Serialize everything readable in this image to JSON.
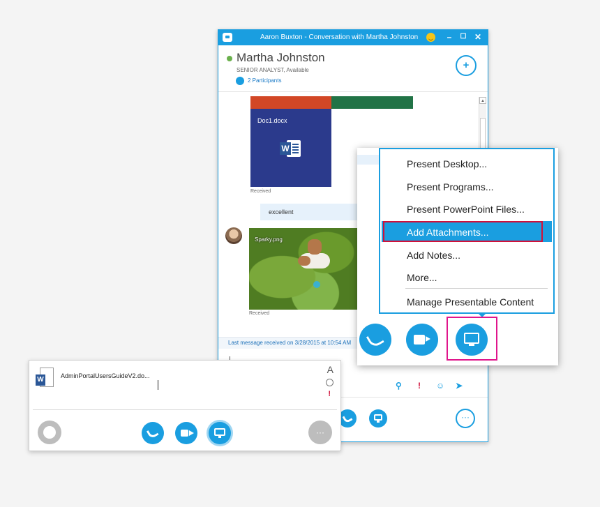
{
  "window": {
    "title": "Aaron Buxton - Conversation with Martha Johnston",
    "min_label": "–",
    "max_label": "☐",
    "close_label": "✕"
  },
  "contact": {
    "name": "Martha Johnston",
    "title_status": "SENIOR ANALYST,  Available",
    "participants": "2 Participants",
    "add_participant_glyph": "+"
  },
  "conversation": {
    "doc_file": "Doc1.docx",
    "doc_icon_letter": "W",
    "received_1": "Received",
    "message": "excellent",
    "photo_file": "Sparky.png",
    "received_2": "Received",
    "last_message": "Last message received on 3/28/2015 at 10:54 AM"
  },
  "toolbar": {
    "attach_glyph": "⚲",
    "important_glyph": "!",
    "emoticon_glyph": "☺",
    "send_glyph": "➤",
    "more_label": "···"
  },
  "present_menu": {
    "items": [
      "Present Desktop...",
      "Present Programs...",
      "Present PowerPoint Files...",
      "Add Attachments...",
      "Add Notes...",
      "More...",
      "Manage Presentable Content"
    ],
    "highlighted_index": 3
  },
  "compose_card": {
    "attachment_name": "AdminPortalUsersGuideV2.do...",
    "attachment_icon_letter": "W",
    "font_glyph": "A",
    "important_glyph": "!",
    "more_label": "···"
  },
  "icons": [
    "chat-app-icon",
    "emoticon-icon",
    "add-participant-icon",
    "participants-icon",
    "word-doc-icon",
    "phone-icon",
    "video-icon",
    "present-icon",
    "paperclip-icon",
    "important-icon",
    "send-icon",
    "more-icon",
    "im-icon",
    "font-icon"
  ],
  "colors": {
    "accent": "#1a9ee0",
    "highlight_outline": "#d0103a",
    "present_outline": "#e0158c",
    "presence_available": "#6ab04c",
    "word_blue": "#2b3a8c"
  }
}
